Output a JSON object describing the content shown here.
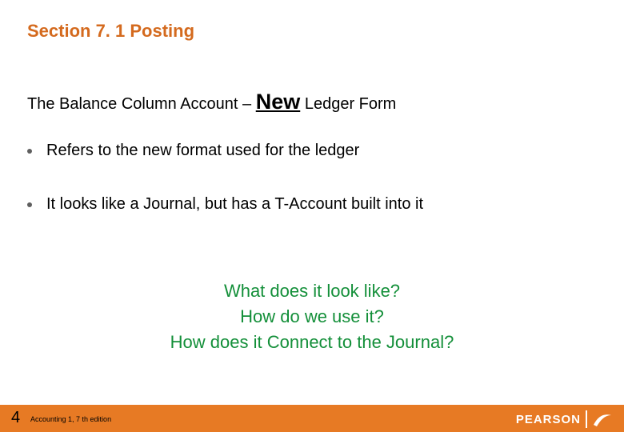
{
  "title": "Section 7. 1 Posting",
  "subtitle": {
    "pre": "The Balance Column Account – ",
    "new": "New",
    "post": " Ledger Form"
  },
  "bullets": [
    "Refers to the new format used for the ledger",
    "It looks like a Journal, but has a T-Account built into it"
  ],
  "questions": [
    "What does it look like?",
    "How do we use it?",
    "How does it Connect to the Journal?"
  ],
  "footer": {
    "page_number": "4",
    "edition_text": "Accounting 1, 7 th edition",
    "brand": "PEARSON"
  },
  "colors": {
    "title": "#d46a1e",
    "questions": "#138f39",
    "footer_bg": "#e77a24"
  }
}
